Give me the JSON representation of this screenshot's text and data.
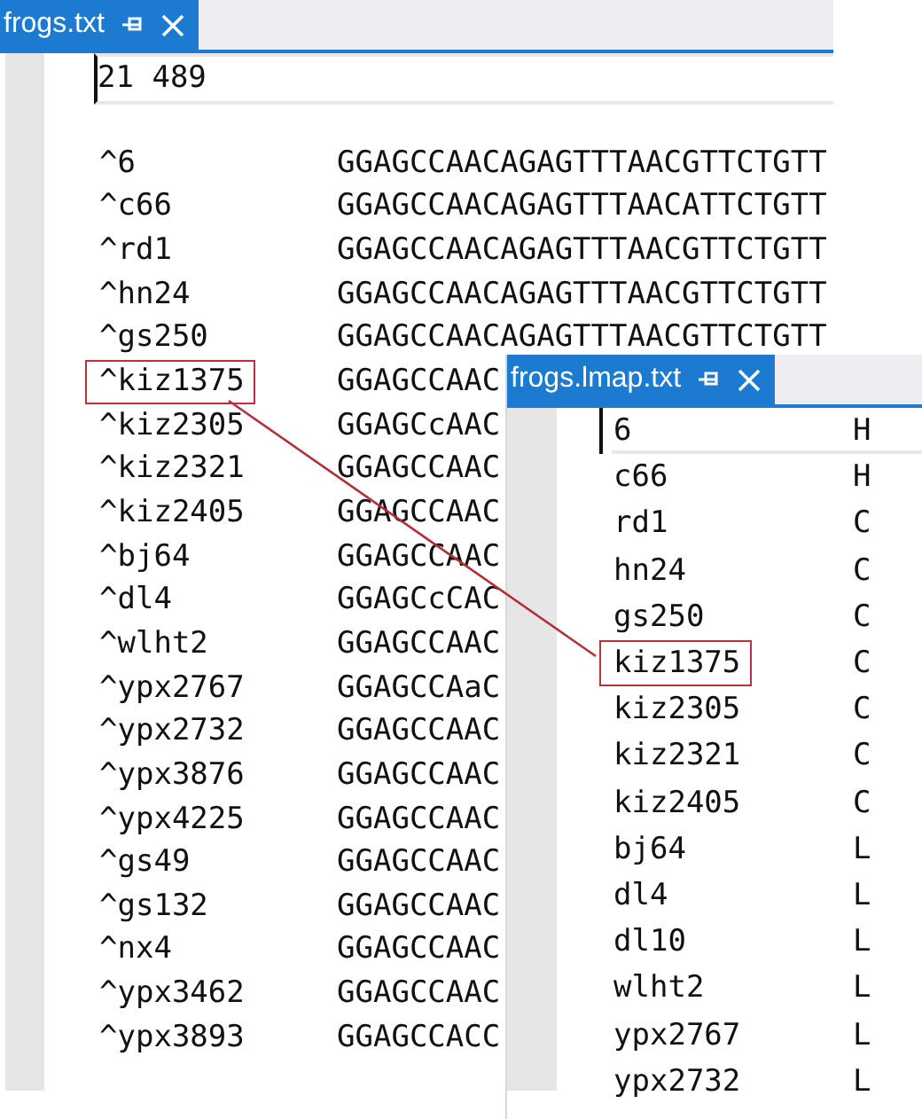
{
  "left_editor": {
    "tab": {
      "title": "frogs.txt",
      "selected": true
    },
    "header_line": {
      "text": "21 489",
      "current": true
    },
    "rows": [
      {
        "name": "^6",
        "sequence": "GGAGCCAACAGAGTTTAACGTTCTGTT",
        "highlighted": false
      },
      {
        "name": "^c66",
        "sequence": "GGAGCCAACAGAGTTTAACATTCTGTT",
        "highlighted": false
      },
      {
        "name": "^rd1",
        "sequence": "GGAGCCAACAGAGTTTAACGTTCTGTT",
        "highlighted": false
      },
      {
        "name": "^hn24",
        "sequence": "GGAGCCAACAGAGTTTAACGTTCTGTT",
        "highlighted": false
      },
      {
        "name": "^gs250",
        "sequence": "GGAGCCAACAGAGTTTAACGTTCTGTT",
        "highlighted": false
      },
      {
        "name": "^kiz1375",
        "sequence": "GGAGCCAAC",
        "highlighted": true
      },
      {
        "name": "^kiz2305",
        "sequence": "GGAGCcAAC",
        "highlighted": false
      },
      {
        "name": "^kiz2321",
        "sequence": "GGAGCCAAC",
        "highlighted": false
      },
      {
        "name": "^kiz2405",
        "sequence": "GGAGCCAAC",
        "highlighted": false
      },
      {
        "name": "^bj64",
        "sequence": "GGAGCCAAC",
        "highlighted": false
      },
      {
        "name": "^dl4",
        "sequence": "GGAGCcCAC",
        "highlighted": false
      },
      {
        "name": "^wlht2",
        "sequence": "GGAGCCAAC",
        "highlighted": false
      },
      {
        "name": "^ypx2767",
        "sequence": "GGAGCCAaC",
        "highlighted": false
      },
      {
        "name": "^ypx2732",
        "sequence": "GGAGCCAAC",
        "highlighted": false
      },
      {
        "name": "^ypx3876",
        "sequence": "GGAGCCAAC",
        "highlighted": false
      },
      {
        "name": "^ypx4225",
        "sequence": "GGAGCCAAC",
        "highlighted": false
      },
      {
        "name": "^gs49",
        "sequence": "GGAGCCAAC",
        "highlighted": false
      },
      {
        "name": "^gs132",
        "sequence": "GGAGCCAAC",
        "highlighted": false
      },
      {
        "name": "^nx4",
        "sequence": "GGAGCCAAC",
        "highlighted": false
      },
      {
        "name": "^ypx3462",
        "sequence": "GGAGCCAAC",
        "highlighted": false
      },
      {
        "name": "^ypx3893",
        "sequence": "GGAGCCACC",
        "highlighted": false
      }
    ]
  },
  "overlay_editor": {
    "tab": {
      "title": "frogs.lmap.txt",
      "selected": true
    },
    "rows": [
      {
        "name": "6",
        "group": "H",
        "highlighted": false,
        "current": true
      },
      {
        "name": "c66",
        "group": "H",
        "highlighted": false,
        "current": false
      },
      {
        "name": "rd1",
        "group": "C",
        "highlighted": false,
        "current": false
      },
      {
        "name": "hn24",
        "group": "C",
        "highlighted": false,
        "current": false
      },
      {
        "name": "gs250",
        "group": "C",
        "highlighted": false,
        "current": false
      },
      {
        "name": "kiz1375",
        "group": "C",
        "highlighted": true,
        "current": false
      },
      {
        "name": "kiz2305",
        "group": "C",
        "highlighted": false,
        "current": false
      },
      {
        "name": "kiz2321",
        "group": "C",
        "highlighted": false,
        "current": false
      },
      {
        "name": "kiz2405",
        "group": "C",
        "highlighted": false,
        "current": false
      },
      {
        "name": "bj64",
        "group": "L",
        "highlighted": false,
        "current": false
      },
      {
        "name": "dl4",
        "group": "L",
        "highlighted": false,
        "current": false
      },
      {
        "name": "dl10",
        "group": "L",
        "highlighted": false,
        "current": false
      },
      {
        "name": "wlht2",
        "group": "L",
        "highlighted": false,
        "current": false
      },
      {
        "name": "ypx2767",
        "group": "L",
        "highlighted": false,
        "current": false
      },
      {
        "name": "ypx2732",
        "group": "L",
        "highlighted": false,
        "current": false
      }
    ]
  }
}
